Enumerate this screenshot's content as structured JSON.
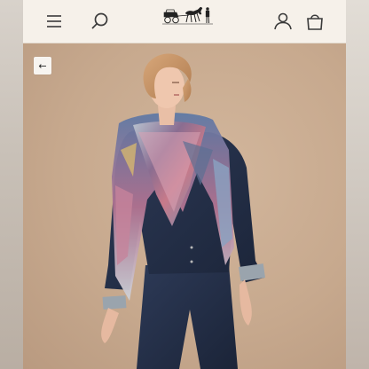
{
  "header": {
    "menu_icon": "hamburger-menu-icon",
    "search_icon": "search-icon",
    "logo_icon": "horse-carriage-logo",
    "account_icon": "user-icon",
    "bag_icon": "shopping-bag-icon"
  },
  "product_gallery": {
    "back_icon": "arrow-left-icon",
    "back_glyph": "←",
    "image_subject": "model-wearing-silk-scarf"
  },
  "colors": {
    "header_bg": "#f6f1ea",
    "hero_bg": "#c9ab90",
    "icon": "#3a3a3a"
  }
}
